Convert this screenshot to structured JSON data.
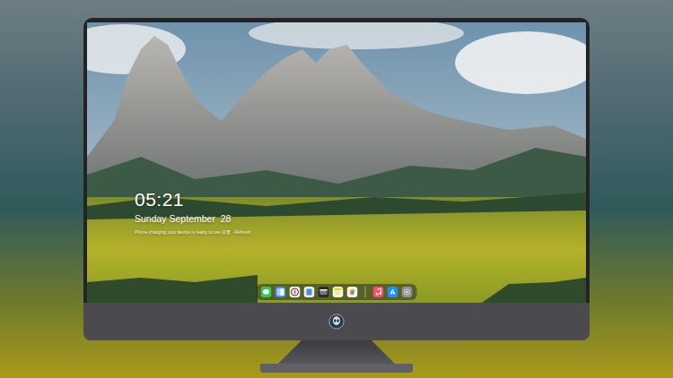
{
  "lock_screen": {
    "time": "05:21",
    "date": "Sunday September  28",
    "notice": "Phone charging your device is ready to use 设置 · Refresh"
  },
  "dock": {
    "groups": [
      [
        {
          "kind": "messages"
        },
        {
          "kind": "finder"
        },
        {
          "kind": "safari"
        },
        {
          "kind": "files"
        },
        {
          "kind": "video"
        },
        {
          "kind": "notes"
        },
        {
          "kind": "photos"
        }
      ],
      [
        {
          "kind": "music"
        },
        {
          "kind": "store"
        },
        {
          "kind": "settings"
        }
      ]
    ]
  }
}
